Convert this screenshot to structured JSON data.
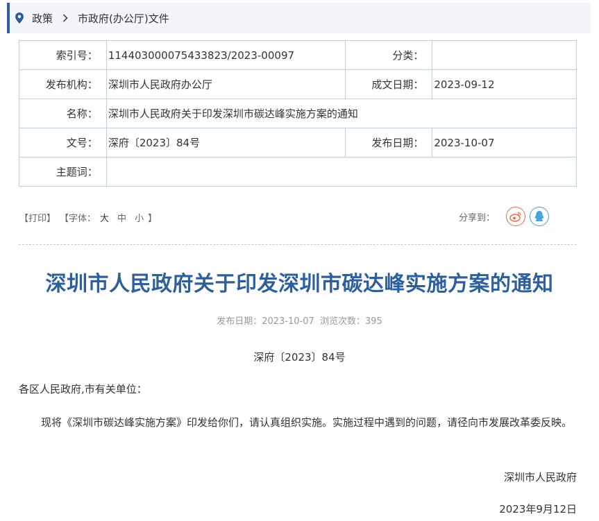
{
  "breadcrumb": {
    "items": [
      "政策",
      "市政府(办公厅)文件"
    ],
    "accent_color": "#2b5f9c"
  },
  "info_table": {
    "index_label": "索引号：",
    "index_value": "11440300007543382З/2023-00097",
    "category_label": "分类：",
    "category_value": "",
    "publisher_label": "发布机构：",
    "publisher_value": "深圳市人民政府办公厅",
    "created_label": "成文日期：",
    "created_value": "2023-09-12",
    "name_label": "名称：",
    "name_value": "深圳市人民政府关于印发深圳市碳达峰实施方案的通知",
    "docno_label": "文号：",
    "docno_value": "深府〔2023〕84号",
    "published_label": "发布日期：",
    "published_value": "2023-10-07",
    "keywords_label": "主题词：",
    "keywords_value": ""
  },
  "tools": {
    "print": "【打印】",
    "font_prefix": "【字体：",
    "font_large": "大",
    "font_medium": "中",
    "font_small": "小",
    "font_suffix": "】"
  },
  "share": {
    "label": "分享到：",
    "icons": [
      "weibo-icon",
      "qq-icon"
    ]
  },
  "article": {
    "title": "深圳市人民政府关于印发深圳市碳达峰实施方案的通知",
    "publish_date_label": "发布日期：2023-10-07",
    "views_label": "浏览次数：395",
    "doc_number": "深府〔2023〕84号",
    "addressee": "各区人民政府,市有关单位：",
    "body": "现将《深圳市碳达峰实施方案》印发给你们，请认真组织实施。实施过程中遇到的问题，请径向市发展改革委反映。",
    "signature_org": "深圳市人民政府",
    "signature_date": "2023年9月12日"
  }
}
